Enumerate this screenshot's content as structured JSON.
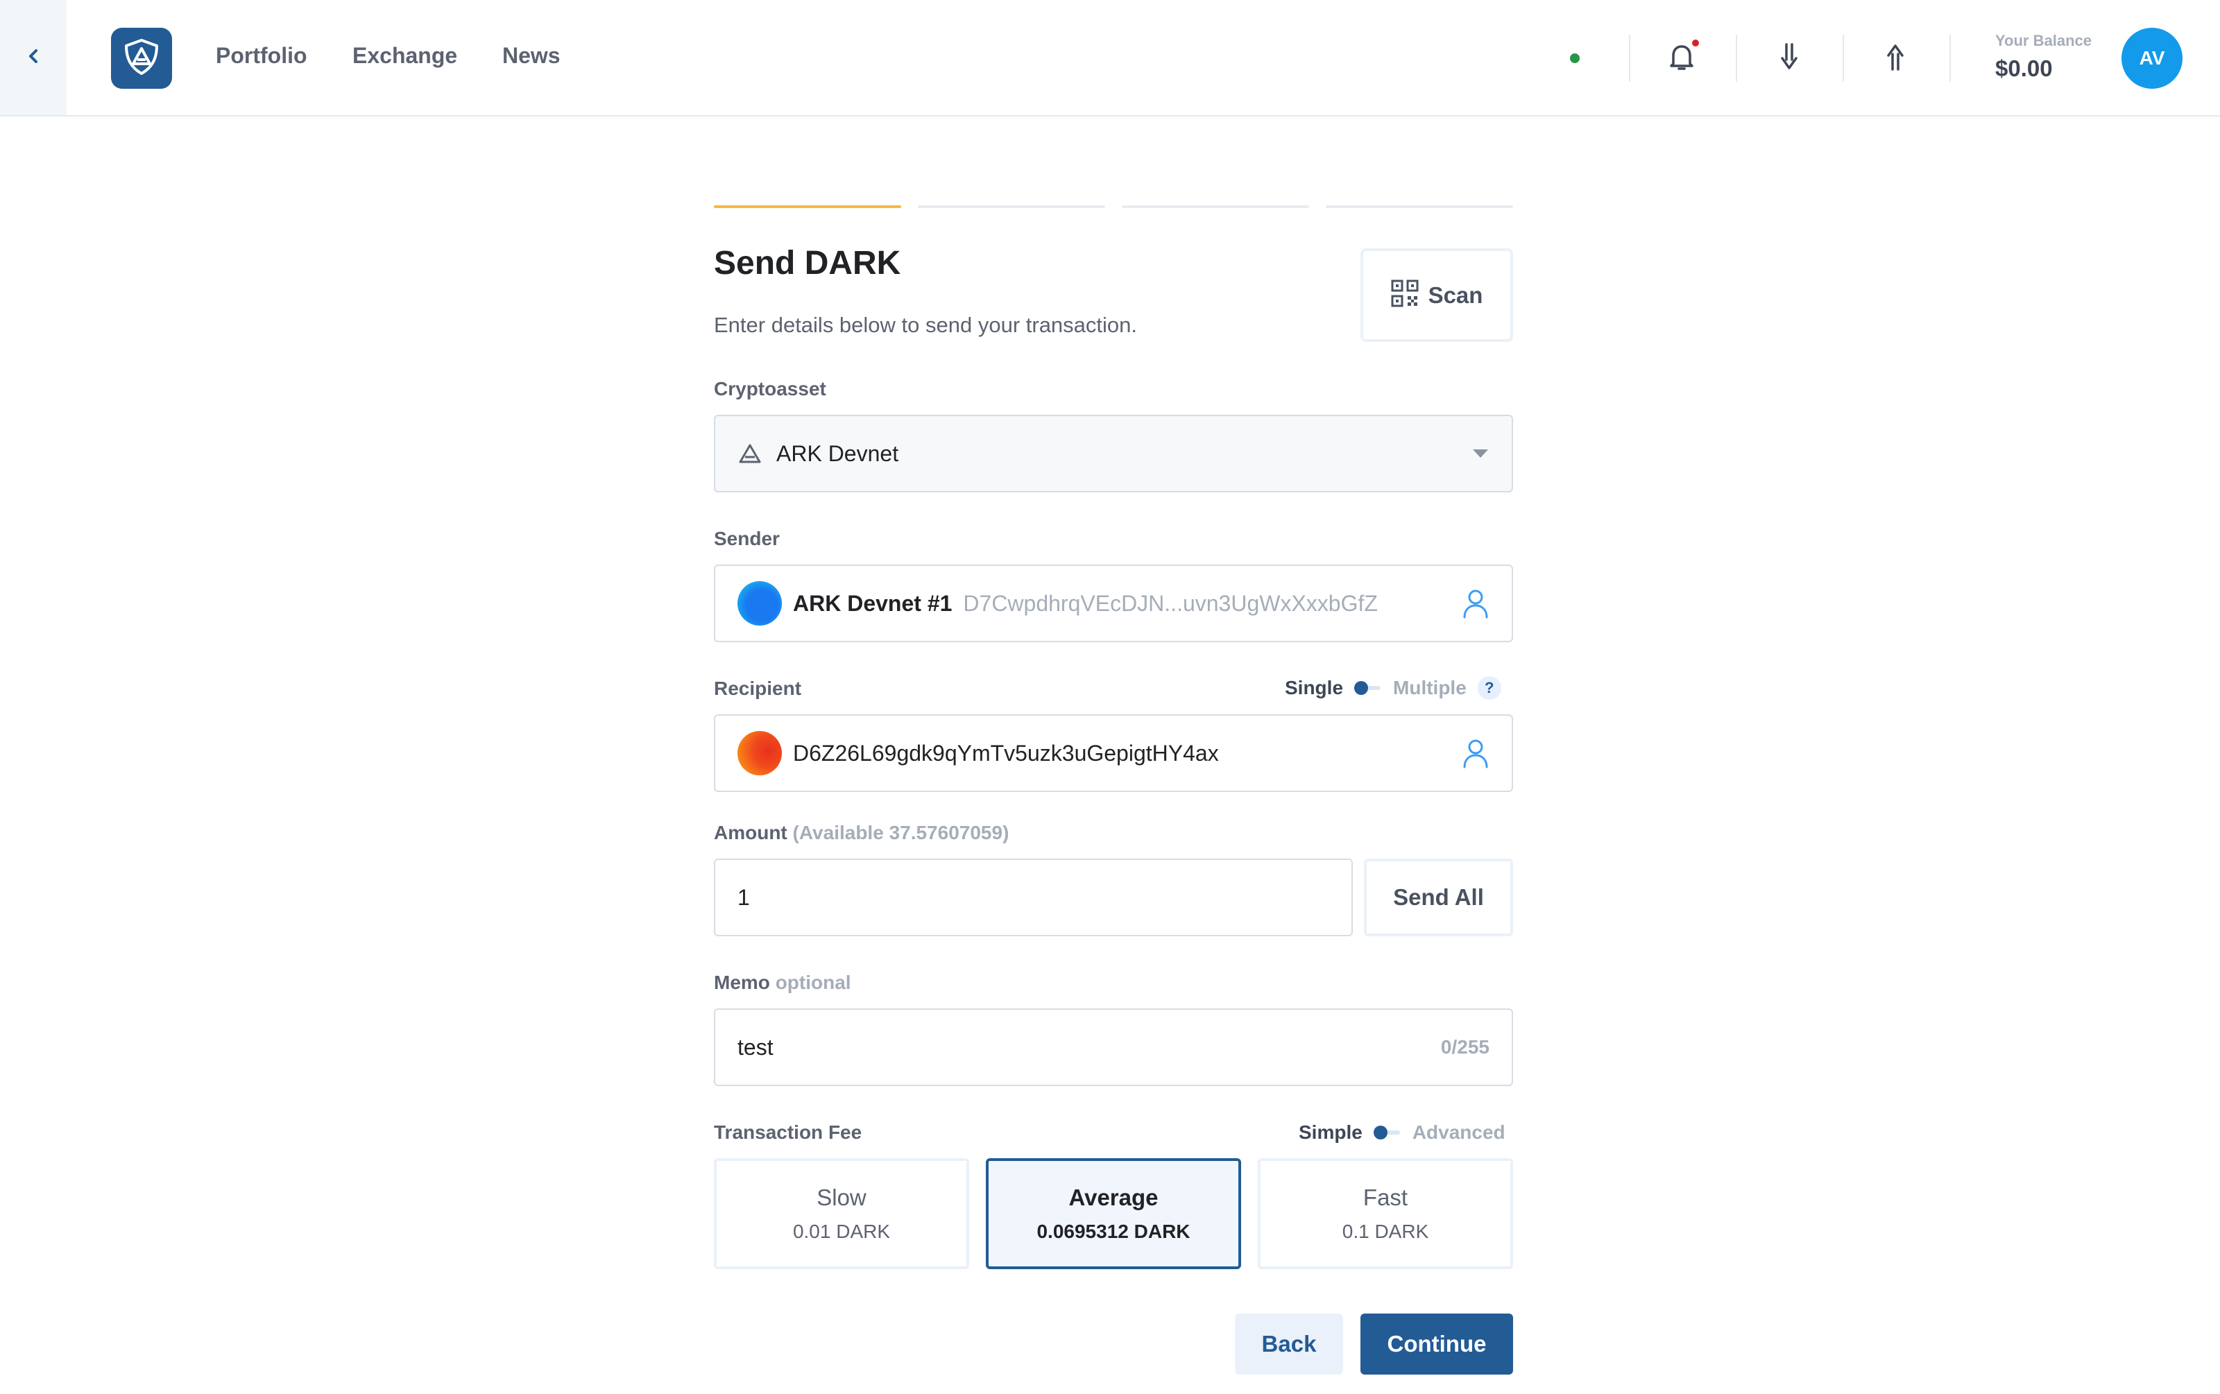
{
  "header": {
    "nav": [
      {
        "label": "Portfolio"
      },
      {
        "label": "Exchange"
      },
      {
        "label": "News"
      }
    ],
    "balance_label": "Your Balance",
    "balance_value": "$0.00",
    "avatar_initials": "AV",
    "icons": {
      "back": "chevron-left-icon",
      "logo": "ark-shield-logo",
      "notifications": "bell-icon",
      "receive": "arrow-down-icon",
      "send": "arrow-up-icon"
    }
  },
  "stepper": {
    "total_steps": 4,
    "active_step": 1
  },
  "form": {
    "title": "Send DARK",
    "subtitle": "Enter details below to send your transaction.",
    "scan_label": "Scan",
    "cryptoasset": {
      "label": "Cryptoasset",
      "value": "ARK Devnet"
    },
    "sender": {
      "label": "Sender",
      "wallet_name": "ARK Devnet #1",
      "address": "D7CwpdhrqVEcDJN...uvn3UgWxXxxbGfZ"
    },
    "recipient": {
      "label": "Recipient",
      "mode_single": "Single",
      "mode_multiple": "Multiple",
      "help": "?",
      "address": "D6Z26L69gdk9qYmTv5uzk3uGepigtHY4ax"
    },
    "amount": {
      "label": "Amount",
      "available": "(Available 37.57607059)",
      "value": "1",
      "send_all_label": "Send All"
    },
    "memo": {
      "label": "Memo",
      "optional": "optional",
      "value": "test",
      "counter": "0/255"
    },
    "fee": {
      "label": "Transaction Fee",
      "mode_simple": "Simple",
      "mode_advanced": "Advanced",
      "options": [
        {
          "name": "Slow",
          "value": "0.01 DARK"
        },
        {
          "name": "Average",
          "value": "0.0695312 DARK"
        },
        {
          "name": "Fast",
          "value": "0.1 DARK"
        }
      ],
      "selected": "Average"
    },
    "back_label": "Back",
    "continue_label": "Continue"
  },
  "colors": {
    "primary": "#235b95",
    "stepper_active": "#f6b940",
    "online": "#289548",
    "notification": "#d92226",
    "avatar": "#139aea"
  }
}
